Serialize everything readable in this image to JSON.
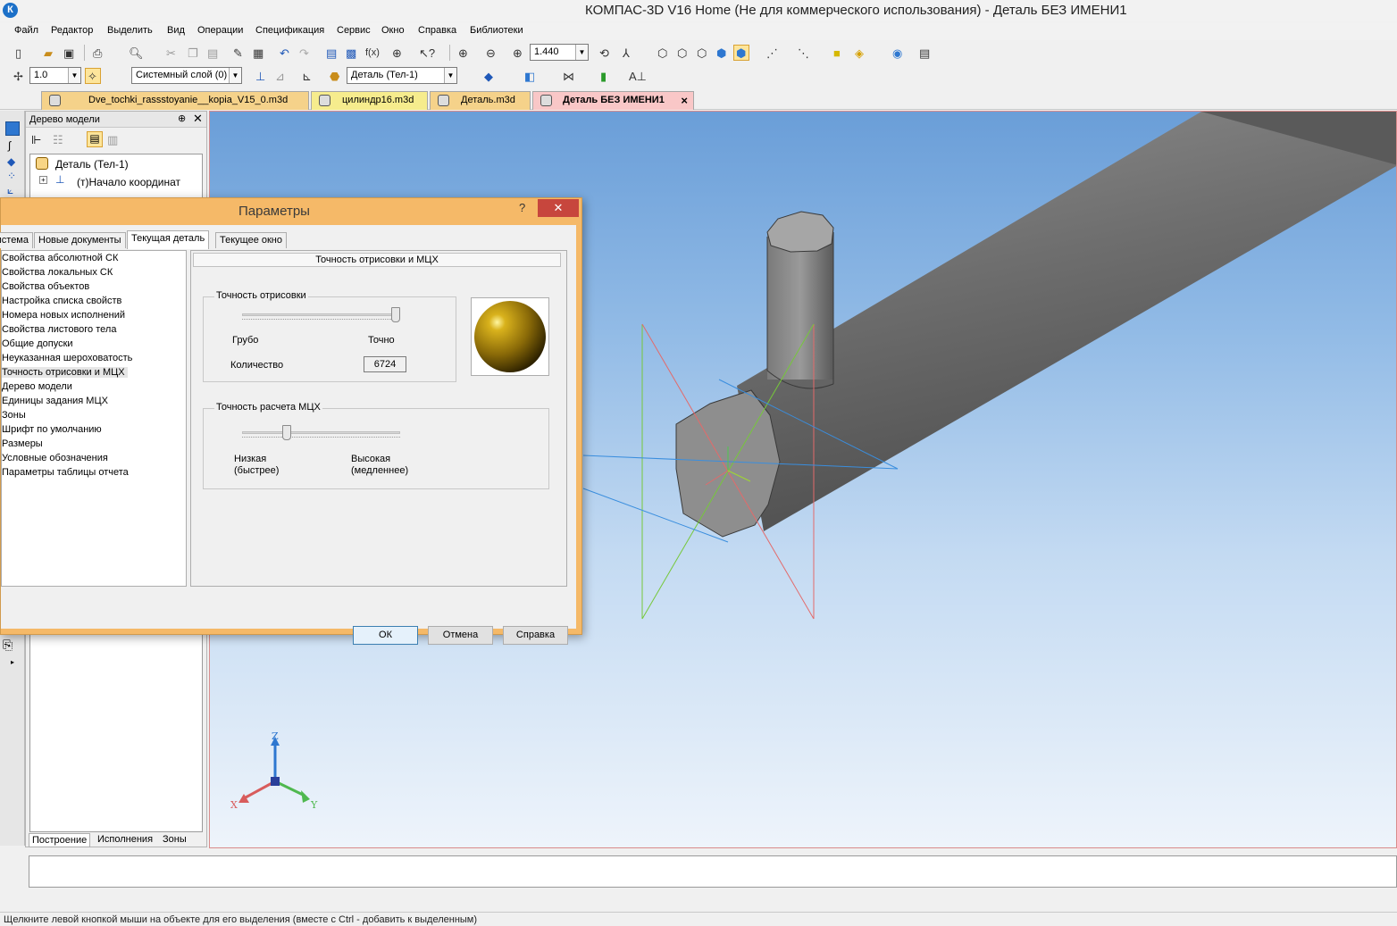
{
  "window": {
    "title": "КОМПАС-3D V16 Home  (Не для коммерческого использования) - Деталь БЕЗ ИМЕНИ1",
    "logo": "К"
  },
  "menu": [
    "Файл",
    "Редактор",
    "Выделить",
    "Вид",
    "Операции",
    "Спецификация",
    "Сервис",
    "Окно",
    "Справка",
    "Библиотеки"
  ],
  "toolbar": {
    "zoom_value": "1.440",
    "step_value": "1.0",
    "layer_value": "Системный слой (0)",
    "part_value": "Деталь (Тел-1)"
  },
  "doc_tabs": [
    {
      "label": "Dve_tochki_rassstoyanie__kopia_V15_0.m3d",
      "color": "#f5d28a"
    },
    {
      "label": "цилиндр16.m3d",
      "color": "#f6ec8d"
    },
    {
      "label": "Деталь.m3d",
      "color": "#f5d28a"
    },
    {
      "label": "Деталь БЕЗ ИМЕНИ1",
      "color": "#f9c7c7",
      "close": "×"
    }
  ],
  "tree_panel": {
    "title": "Дерево модели",
    "pin": "⊕",
    "close": "✕",
    "root": "Деталь (Тел-1)",
    "child": "(т)Начало координат",
    "bottom_tabs": [
      "Построение",
      "Исполнения",
      "Зоны"
    ]
  },
  "dialog": {
    "title": "Параметры",
    "help": "?",
    "close": "✕",
    "tabs": [
      "Система",
      "Новые документы",
      "Текущая деталь",
      "Текущее окно"
    ],
    "active_tab": 2,
    "list": [
      "Свойства абсолютной СК",
      "Свойства локальных СК",
      "Свойства объектов",
      "Настройка списка свойств",
      "Номера новых исполнений",
      "Свойства листового тела",
      "Общие допуски",
      "Неуказанная шероховатость",
      "Точность отрисовки и МЦХ",
      "Дерево модели",
      "Единицы задания МЦХ",
      "Зоны",
      "Шрифт по умолчанию",
      "Размеры",
      "Условные обозначения",
      "Параметры таблицы отчета"
    ],
    "selected_index": 8,
    "section_title": "Точность отрисовки и МЦХ",
    "render_group": {
      "title": "Точность отрисовки",
      "low": "Грубо",
      "high": "Точно",
      "count_label": "Количество",
      "count_value": "6724",
      "slider_level": 1.0
    },
    "calc_group": {
      "title": "Точность расчета МЦХ",
      "low_line1": "Низкая",
      "low_line2": "(быстрее)",
      "high_line1": "Высокая",
      "high_line2": "(медленнее)",
      "slider_level": 0.27
    },
    "buttons": {
      "ok": "ОК",
      "cancel": "Отмена",
      "help": "Справка"
    }
  },
  "triad": {
    "z": "Z",
    "x": "X",
    "y": "Y"
  },
  "status": "Щелкните левой кнопкой мыши на объекте для его выделения (вместе с Ctrl - добавить к выделенным)"
}
